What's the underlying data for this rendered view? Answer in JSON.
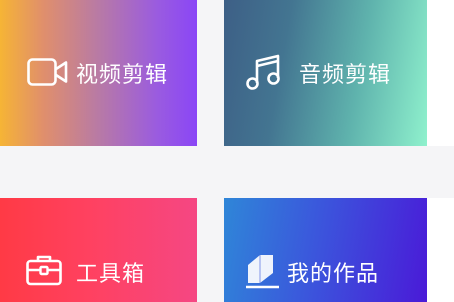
{
  "cards": {
    "video_edit": {
      "label": "视频剪辑",
      "icon": "video-camera-icon"
    },
    "audio_edit": {
      "label": "音频剪辑",
      "icon": "music-note-icon"
    },
    "tools": {
      "label": "工具箱",
      "icon": "toolbox-icon"
    },
    "my_works": {
      "label": "我的作品",
      "icon": "book-icon"
    }
  },
  "colors": {
    "video_gradient": [
      "#f6b435",
      "#b87aa5",
      "#8a46f6"
    ],
    "audio_gradient": [
      "#3d5f86",
      "#5fb3ad",
      "#8ff1cd"
    ],
    "tools_gradient": [
      "#ff3a45",
      "#ff4160",
      "#f54783"
    ],
    "works_gradient": [
      "#2f86d8",
      "#3b56dc",
      "#4a1ad8"
    ],
    "gutter": "#f5f5f7",
    "text": "#ffffff"
  }
}
